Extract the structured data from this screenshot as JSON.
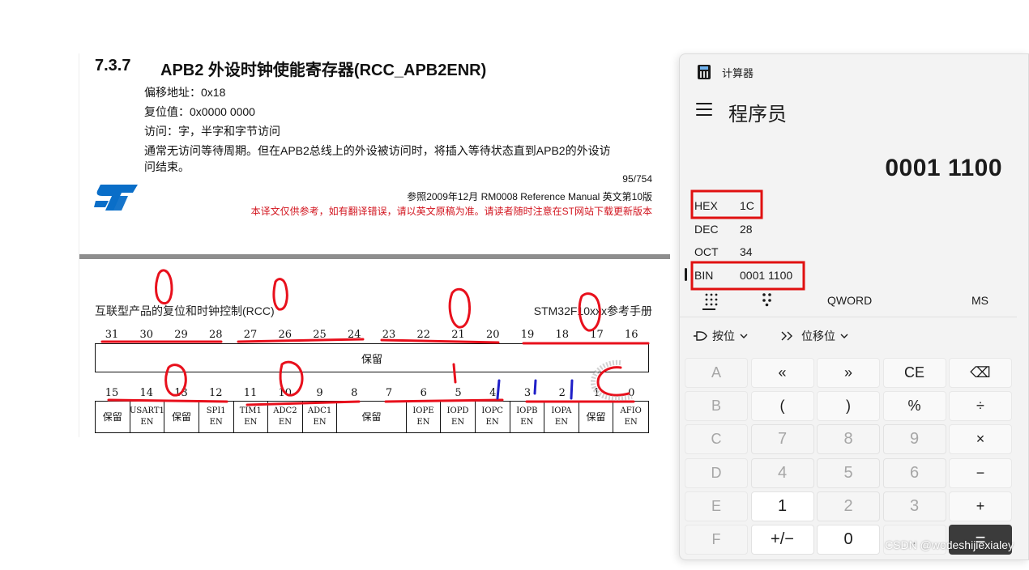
{
  "manual": {
    "section_number": "7.3.7",
    "section_title": "APB2 外设时钟使能寄存器(RCC_APB2ENR)",
    "offset": "偏移地址：0x18",
    "reset_value": "复位值：0x0000 0000",
    "access": "访问：字，半字和字节访问",
    "description_line1": "通常无访问等待周期。但在APB2总线上的外设被访问时，将插入等待状态直到APB2的外设访",
    "description_line2": "问结束。",
    "page_number": "95/754",
    "reference": "参照2009年12月 RM0008 Reference Manual  英文第10版",
    "translation_note": "本译文仅供参考，如有翻译错误，请以英文原稿为准。请读者随时注意在ST网站下载更新版本",
    "header_left": "互联型产品的复位和时钟控制(RCC)",
    "header_right": "STM32F10xxx参考手册",
    "bits_high": [
      "31",
      "30",
      "29",
      "28",
      "27",
      "26",
      "25",
      "24",
      "23",
      "22",
      "21",
      "20",
      "19",
      "18",
      "17",
      "16"
    ],
    "reserved_label": "保留",
    "bits_low": [
      "15",
      "14",
      "13",
      "12",
      "11",
      "10",
      "9",
      "8",
      "7",
      "6",
      "5",
      "4",
      "3",
      "2",
      "1",
      "0"
    ],
    "register_fields": [
      {
        "line1": "保留",
        "line2": ""
      },
      {
        "line1": "USART1",
        "line2": "EN"
      },
      {
        "line1": "保留",
        "line2": ""
      },
      {
        "line1": "SPI1",
        "line2": "EN"
      },
      {
        "line1": "TIM1",
        "line2": "EN"
      },
      {
        "line1": "ADC2",
        "line2": "EN"
      },
      {
        "line1": "ADC1",
        "line2": "EN"
      },
      {
        "line1": "保留",
        "line2": ""
      },
      {
        "line1": "IOPE",
        "line2": "EN"
      },
      {
        "line1": "IOPD",
        "line2": "EN"
      },
      {
        "line1": "IOPC",
        "line2": "EN"
      },
      {
        "line1": "IOPB",
        "line2": "EN"
      },
      {
        "line1": "IOPA",
        "line2": "EN"
      },
      {
        "line1": "保留",
        "line2": ""
      },
      {
        "line1": "AFIO",
        "line2": "EN"
      }
    ]
  },
  "calculator": {
    "window_title": "计算器",
    "mode_title": "程序员",
    "display_value": "0001 1100",
    "radix": [
      {
        "label": "HEX",
        "value": "1C"
      },
      {
        "label": "DEC",
        "value": "28"
      },
      {
        "label": "OCT",
        "value": "34"
      },
      {
        "label": "BIN",
        "value": "0001 1100"
      }
    ],
    "word_size": "QWORD",
    "memory_store": "MS",
    "bitwise_label": "按位",
    "bitshift_label": "位移位",
    "keys": [
      [
        "A",
        "«",
        "»",
        "CE",
        "⌫"
      ],
      [
        "B",
        "(",
        ")",
        "%",
        "÷"
      ],
      [
        "C",
        "7",
        "8",
        "9",
        "×"
      ],
      [
        "D",
        "4",
        "5",
        "6",
        "−"
      ],
      [
        "E",
        "1",
        "2",
        "3",
        "+"
      ],
      [
        "F",
        "+/−",
        "0",
        ".",
        "="
      ]
    ]
  },
  "watermark": "CSDN @wodeshijiexialey",
  "colors": {
    "annotation_red": "#e8101c",
    "annotation_blue": "#1f1fc8",
    "highlight_box": "#e01010",
    "note_red": "#d2141e",
    "st_logo_blue": "#0a6ec8"
  }
}
